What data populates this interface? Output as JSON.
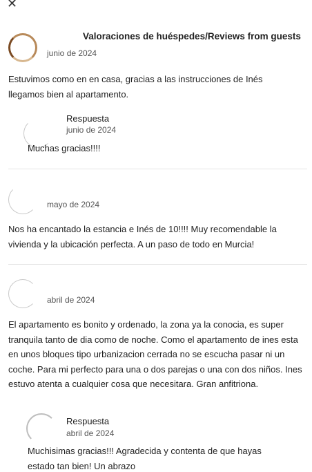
{
  "header": {
    "close_icon": "✕",
    "title": "Valoraciones de huéspedes/Reviews from guests"
  },
  "reviews": [
    {
      "date": "junio de 2024",
      "text": "Estuvimos como en en casa, gracias a las instrucciones de Inés llegamos bien al apartamento.",
      "response": {
        "label": "Respuesta",
        "date": "junio de 2024",
        "text": "Muchas gracias!!!!"
      }
    },
    {
      "date": "mayo de 2024",
      "text": "Nos ha encantado la estancia e Inés de 10!!!! Muy recomendable la vivienda y la ubicación perfecta. A un paso de todo en Murcia!"
    },
    {
      "date": "abril de 2024",
      "text": "El apartamento es bonito y ordenado, la zona ya la conocia, es super tranquila tanto de dia como de noche. Como el apartamento de ines esta en unos bloques tipo urbanizacion cerrada no se escucha pasar ni un coche. Para mi perfecto para una o dos parejas o una con dos niños. Ines estuvo atenta a cualquier cosa que necesitara. Gran anfitriona.",
      "response": {
        "label": "Respuesta",
        "date": "abril de 2024",
        "text": "Muchisimas gracias!!! Agradecida y contenta de que hayas estado tan bien! Un abrazo"
      }
    }
  ]
}
